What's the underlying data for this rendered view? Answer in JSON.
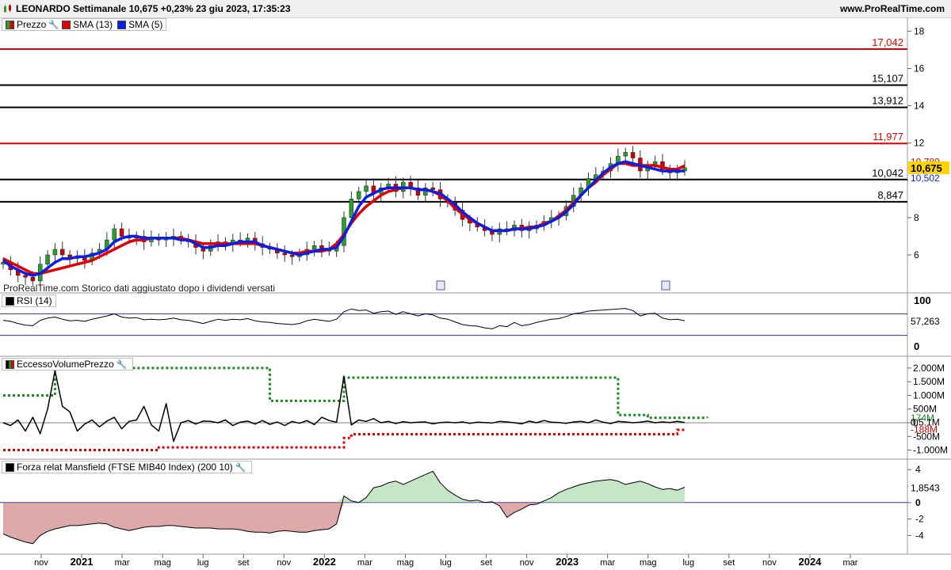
{
  "header": {
    "title": "LEONARDO Settimanale 10,675 +0,23% 23 giu 2023, 17:35:23",
    "site": "www.ProRealTime.com"
  },
  "legends": {
    "price": [
      {
        "label": "Prezzo",
        "color": "#2a9d2a"
      },
      {
        "label": "SMA (13)",
        "color": "#e10000"
      },
      {
        "label": "SMA (5)",
        "color": "#0a1ee6"
      }
    ],
    "rsi": "RSI (14)",
    "volume": "EccessoVolumePrezzo",
    "mansfield": "Forza relat Mansfield (FTSE MIB40 Index) (200 10)"
  },
  "note": "ProRealTime.com  Storico dati aggiustato dopo i dividendi versati",
  "chart_data": {
    "type": "line",
    "x_labels": [
      "nov",
      "2021",
      "mar",
      "mag",
      "lug",
      "set",
      "nov",
      "2022",
      "mar",
      "mag",
      "lug",
      "set",
      "nov",
      "2023",
      "mar",
      "mag",
      "lug",
      "set",
      "nov",
      "2024",
      "mar"
    ],
    "price_panel": {
      "y_ticks": [
        "18",
        "16",
        "14",
        "12",
        "10",
        "8",
        "6"
      ],
      "ylim": [
        4.3,
        18.4
      ],
      "levels": [
        {
          "value": 17.042,
          "label": "17,042",
          "color": "#e10000"
        },
        {
          "value": 15.107,
          "label": "15,107",
          "color": "#000000"
        },
        {
          "value": 13.912,
          "label": "13,912",
          "color": "#000000"
        },
        {
          "value": 11.977,
          "label": "11,977",
          "color": "#e10000"
        },
        {
          "value": 10.042,
          "label": "10,042",
          "color": "#000000"
        },
        {
          "value": 8.847,
          "label": "8,847",
          "color": "#000000"
        }
      ],
      "last_price": {
        "value": 10.675,
        "label": "10,675"
      },
      "sma13_last": {
        "value": 10.78,
        "label": "10,780"
      },
      "sma5_last": {
        "value": 10.502,
        "label": "10,502"
      },
      "close": [
        5.6,
        5.2,
        4.9,
        4.8,
        4.6,
        5.5,
        6.0,
        6.3,
        6.0,
        5.8,
        5.9,
        5.7,
        6.1,
        6.3,
        6.8,
        7.4,
        7.0,
        6.9,
        7.0,
        6.7,
        6.9,
        6.8,
        6.9,
        7.0,
        6.8,
        6.7,
        6.4,
        6.2,
        6.5,
        6.7,
        6.6,
        6.8,
        6.7,
        6.9,
        6.6,
        6.4,
        6.3,
        6.1,
        6.0,
        5.9,
        6.0,
        6.3,
        6.5,
        6.3,
        6.2,
        6.5,
        8.0,
        9.0,
        9.4,
        9.7,
        9.3,
        9.6,
        9.8,
        9.4,
        9.9,
        9.6,
        9.2,
        9.6,
        9.5,
        9.0,
        8.8,
        8.4,
        7.9,
        7.7,
        7.5,
        7.3,
        7.1,
        7.4,
        7.3,
        7.6,
        7.3,
        7.4,
        7.6,
        7.8,
        8.0,
        8.1,
        8.6,
        9.2,
        9.6,
        10.1,
        10.3,
        10.5,
        10.9,
        11.3,
        11.5,
        11.2,
        10.5,
        10.8,
        11.0,
        10.6,
        10.4,
        10.5,
        10.675
      ],
      "sma13": [
        5.8,
        5.6,
        5.4,
        5.2,
        5.0,
        5.0,
        5.1,
        5.2,
        5.3,
        5.4,
        5.5,
        5.6,
        5.7,
        5.9,
        6.1,
        6.3,
        6.5,
        6.7,
        6.8,
        6.8,
        6.9,
        6.9,
        6.9,
        6.9,
        6.9,
        6.8,
        6.7,
        6.6,
        6.6,
        6.6,
        6.6,
        6.6,
        6.6,
        6.6,
        6.6,
        6.5,
        6.4,
        6.3,
        6.2,
        6.1,
        6.1,
        6.2,
        6.2,
        6.2,
        6.3,
        6.6,
        7.1,
        7.7,
        8.2,
        8.6,
        8.9,
        9.2,
        9.4,
        9.5,
        9.6,
        9.6,
        9.5,
        9.5,
        9.4,
        9.2,
        8.9,
        8.5,
        8.2,
        7.9,
        7.7,
        7.5,
        7.3,
        7.3,
        7.3,
        7.4,
        7.4,
        7.5,
        7.5,
        7.7,
        7.8,
        8.1,
        8.4,
        8.8,
        9.2,
        9.6,
        9.9,
        10.3,
        10.6,
        10.9,
        10.9,
        10.8,
        10.8,
        10.8,
        10.8,
        10.7,
        10.6,
        10.6,
        10.78
      ],
      "sma5": [
        5.7,
        5.4,
        5.2,
        5.0,
        4.9,
        5.0,
        5.3,
        5.6,
        5.8,
        5.8,
        5.9,
        5.9,
        6.0,
        6.1,
        6.3,
        6.7,
        6.9,
        7.0,
        7.0,
        6.9,
        6.9,
        6.9,
        6.9,
        6.9,
        6.8,
        6.8,
        6.6,
        6.4,
        6.4,
        6.5,
        6.5,
        6.6,
        6.7,
        6.7,
        6.7,
        6.5,
        6.4,
        6.3,
        6.2,
        6.1,
        6.0,
        6.1,
        6.2,
        6.3,
        6.3,
        6.4,
        7.0,
        7.8,
        8.6,
        9.1,
        9.3,
        9.5,
        9.6,
        9.6,
        9.6,
        9.6,
        9.5,
        9.5,
        9.4,
        9.3,
        9.0,
        8.7,
        8.3,
        8.0,
        7.7,
        7.5,
        7.3,
        7.3,
        7.3,
        7.4,
        7.4,
        7.4,
        7.5,
        7.6,
        7.8,
        8.0,
        8.3,
        8.7,
        9.2,
        9.6,
        10.0,
        10.4,
        10.7,
        10.9,
        11.0,
        10.9,
        10.8,
        10.7,
        10.6,
        10.5,
        10.5,
        10.5,
        10.502
      ]
    },
    "rsi_panel": {
      "y_ticks": [
        "100",
        "0"
      ],
      "bands": [
        70,
        30
      ],
      "last": {
        "value": 57.263,
        "label": "57,263"
      },
      "values": [
        58,
        56,
        52,
        49,
        48,
        58,
        62,
        64,
        60,
        57,
        58,
        56,
        60,
        63,
        66,
        70,
        64,
        62,
        63,
        59,
        60,
        59,
        60,
        62,
        59,
        58,
        55,
        52,
        56,
        60,
        58,
        60,
        59,
        61,
        57,
        55,
        54,
        52,
        51,
        50,
        52,
        57,
        60,
        58,
        56,
        60,
        74,
        79,
        76,
        77,
        71,
        74,
        75,
        69,
        74,
        70,
        66,
        70,
        68,
        62,
        60,
        55,
        50,
        48,
        47,
        44,
        42,
        48,
        46,
        54,
        48,
        50,
        54,
        57,
        60,
        61,
        65,
        70,
        72,
        75,
        76,
        77,
        78,
        79,
        80,
        76,
        66,
        70,
        71,
        62,
        59,
        60,
        57.263
      ]
    },
    "volume_panel": {
      "y_ticks": [
        "2.000M",
        "1.500M",
        "1.000M",
        "500M",
        "0",
        "-500M",
        "-1.000M"
      ],
      "ylim": [
        -1100,
        2200
      ],
      "labels": {
        "upper": "174M",
        "mid": "0.5.1M",
        "lower": "-188M"
      },
      "upper_band": [
        1000,
        1000,
        1000,
        1000,
        1000,
        1000,
        1000,
        2000,
        2000,
        2000,
        2000,
        2000,
        2000,
        2000,
        2000,
        2000,
        2000,
        2000,
        2000,
        2000,
        2000,
        2000,
        2000,
        2000,
        2000,
        2000,
        2000,
        2000,
        2000,
        2000,
        2000,
        2000,
        2000,
        2000,
        2000,
        2000,
        800,
        800,
        800,
        800,
        800,
        800,
        800,
        800,
        800,
        800,
        1650,
        1650,
        1650,
        1650,
        1650,
        1650,
        1650,
        1650,
        1650,
        1650,
        1650,
        1650,
        1650,
        1650,
        1650,
        1650,
        1650,
        1650,
        1650,
        1650,
        1650,
        1650,
        1650,
        1650,
        1650,
        1650,
        1650,
        1650,
        1650,
        1650,
        1650,
        1650,
        1650,
        1650,
        1650,
        1650,
        1650,
        280,
        280,
        280,
        280,
        180,
        180,
        180,
        180,
        180,
        180,
        180,
        180,
        174
      ],
      "lower_band": [
        -1000,
        -1000,
        -1000,
        -1000,
        -1000,
        -1000,
        -1000,
        -1000,
        -1000,
        -1000,
        -1000,
        -1000,
        -1000,
        -1000,
        -1000,
        -1000,
        -1000,
        -1000,
        -1000,
        -1000,
        -1000,
        -900,
        -900,
        -900,
        -900,
        -900,
        -900,
        -900,
        -900,
        -900,
        -900,
        -900,
        -900,
        -900,
        -900,
        -900,
        -900,
        -900,
        -900,
        -900,
        -900,
        -900,
        -900,
        -900,
        -900,
        -900,
        -560,
        -420,
        -420,
        -420,
        -420,
        -420,
        -420,
        -420,
        -420,
        -420,
        -420,
        -420,
        -420,
        -420,
        -420,
        -420,
        -420,
        -420,
        -420,
        -420,
        -420,
        -420,
        -420,
        -420,
        -420,
        -420,
        -420,
        -420,
        -420,
        -420,
        -420,
        -420,
        -420,
        -420,
        -420,
        -420,
        -420,
        -420,
        -420,
        -420,
        -420,
        -420,
        -420,
        -420,
        -420,
        -260,
        -188
      ],
      "values": [
        0,
        -100,
        100,
        -300,
        200,
        -400,
        500,
        1900,
        600,
        400,
        -300,
        -50,
        100,
        -150,
        60,
        200,
        -220,
        50,
        100,
        600,
        -80,
        -300,
        700,
        -680,
        0,
        80,
        -50,
        60,
        50,
        0,
        100,
        -100,
        20,
        60,
        -50,
        80,
        -60,
        30,
        -100,
        50,
        -20,
        80,
        -70,
        200,
        80,
        20,
        1700,
        -80,
        100,
        50,
        150,
        0,
        50,
        -30,
        40,
        0,
        20,
        30,
        -40,
        10,
        20,
        0,
        30,
        -20,
        20,
        10,
        -10,
        50,
        30,
        0,
        -40,
        60,
        0,
        80,
        20,
        10,
        -20,
        30,
        50,
        0,
        100,
        20,
        -30,
        50,
        30,
        0,
        20,
        60,
        0,
        30,
        5,
        50,
        5
      ]
    },
    "mansfield_panel": {
      "y_ticks": [
        "4",
        "2",
        "0",
        "-2",
        "-4"
      ],
      "ylim": [
        -5.5,
        4.5
      ],
      "last": {
        "value": 1.8543,
        "label": "1,8543"
      },
      "values": [
        -3.8,
        -4.2,
        -4.5,
        -4.8,
        -5.0,
        -4.0,
        -3.5,
        -3.2,
        -3.0,
        -2.8,
        -2.8,
        -2.7,
        -2.6,
        -2.5,
        -2.6,
        -3.0,
        -3.2,
        -3.4,
        -3.2,
        -3.0,
        -2.9,
        -2.9,
        -2.8,
        -2.8,
        -2.9,
        -3.0,
        -3.1,
        -3.1,
        -3.1,
        -3.2,
        -3.2,
        -3.2,
        -3.3,
        -3.5,
        -3.6,
        -3.6,
        -3.7,
        -3.5,
        -3.4,
        -3.5,
        -3.6,
        -3.6,
        -3.4,
        -3.3,
        -3.2,
        -2.6,
        0.8,
        0.2,
        0.0,
        0.6,
        1.8,
        2.0,
        2.4,
        2.6,
        2.2,
        2.6,
        3.0,
        3.4,
        3.8,
        2.4,
        1.5,
        0.9,
        0.4,
        0.2,
        0.3,
        0.0,
        0.1,
        -0.4,
        -1.8,
        -1.2,
        -0.8,
        -0.3,
        -0.2,
        0.2,
        0.6,
        1.2,
        1.6,
        1.9,
        2.2,
        2.4,
        2.6,
        2.7,
        2.8,
        2.6,
        2.2,
        2.4,
        2.6,
        2.3,
        1.9,
        1.6,
        1.7,
        1.5,
        1.8543
      ]
    }
  }
}
